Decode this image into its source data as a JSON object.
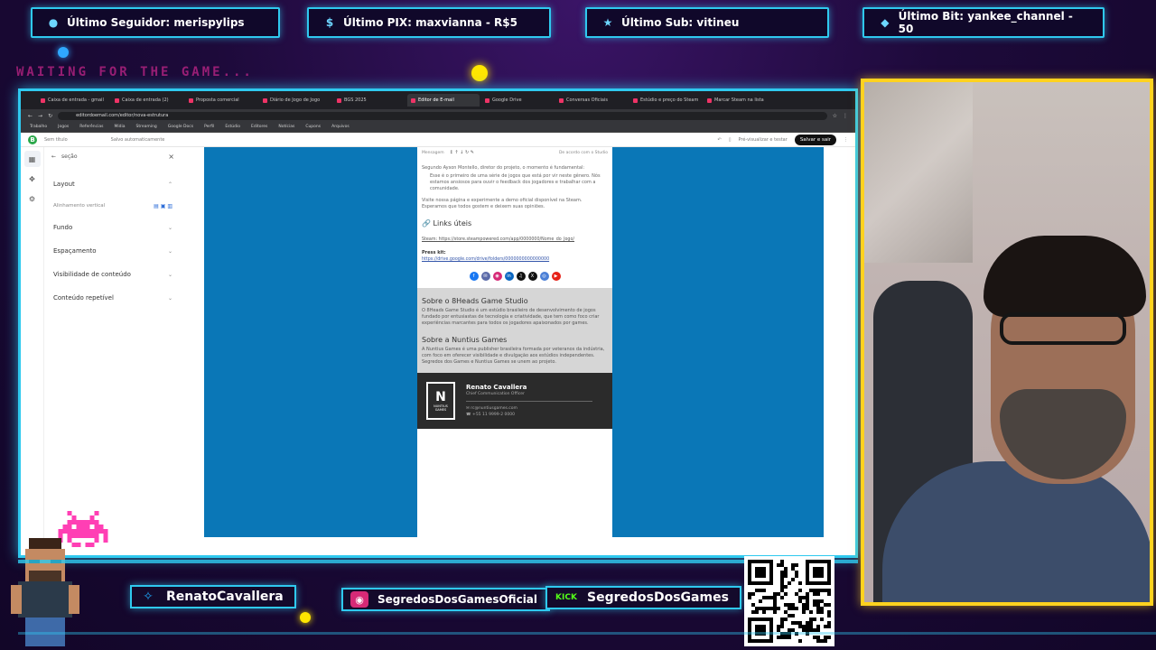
{
  "stats": {
    "follower": "Último Seguidor: merispylips",
    "pix": "Último PIX: maxvianna - R$5",
    "sub": "Último Sub: vitineu",
    "bit": "Último Bit: yankee_channel - 50"
  },
  "waiting_text": "WAITING FOR THE GAME...",
  "browser": {
    "tabs": [
      "Caixa de entrada - gmail",
      "Caixa de entrada (2)",
      "Proposta comercial",
      "Diário de Jogo de Jogo",
      "BGS 2025",
      "Editor de E-mail",
      "Google Drive",
      "Conversas Oficiais",
      "Estúdio e preço do Steam",
      "Marcar Steam na lista"
    ],
    "url": "editordoemail.com/editor/nova-estrutura",
    "bookmarks": [
      "Trabalho",
      "Jogos",
      "Referências",
      "Mídia",
      "Streaming",
      "Google Docs",
      "Perfil",
      "Estúdio",
      "Editores",
      "Notícias",
      "Cupons",
      "Arquivos"
    ]
  },
  "editor": {
    "breadcrumb": "Sem título",
    "autosave": "Salvo automaticamente",
    "preview_label": "Pré-visualizar e testar",
    "save_label": "Salvar e sair",
    "panel_title": "seção",
    "panel_rows": [
      "Layout",
      "Alinhamento vertical",
      "Fundo",
      "Espaçamento",
      "Visibilidade de conteúdo",
      "Conteúdo repetível"
    ]
  },
  "email": {
    "intro_label": "Mensagem",
    "toolbar_note": "De acordo com o Studio",
    "quote_author": "Segundo Ayson Montello, diretor do projeto, o momento é fundamental:",
    "quote_text": "Esse é o primeiro de uma série de jogos que está por vir neste gênero. Nós estamos ansiosos para ouvir o feedback dos jogadores e trabalhar com a comunidade.",
    "demo_text": "Visite nossa página e experimente a demo oficial disponível na Steam. Esperamos que todos gostem e deixem suas opiniões.",
    "links_title": "Links úteis",
    "steam_link": "Steam: https://store.steampowered.com/app/0000000/Nome_do_Jogo/",
    "press_label": "Press kit:",
    "press_link": "https://drive.google.com/drive/folders/0000000000000000",
    "sobre1_title": "Sobre o 8Heads Game Studio",
    "sobre1_text": "O 8Heads Game Studio é um estúdio brasileiro de desenvolvimento de jogos fundado por entusiastas de tecnologia e criatividade, que tem como foco criar experiências marcantes para todos os jogadores apaixonados por games.",
    "sobre2_title": "Sobre a Nuntius Games",
    "sobre2_text": "A Nuntius Games é uma publisher brasileira formada por veteranos da indústria, com foco em oferecer visibilidade e divulgação aos estúdios independentes. Segredos dos Games e Nuntius Games se unem ao projeto.",
    "sig_name": "Renato Cavallera",
    "sig_role": "Chief Communication Officer",
    "sig_email": "rc@nuntiusgames.com",
    "sig_phone": "+55 11 9999-2 0000",
    "sig_logo_text": "NUNTIUS GAMES"
  },
  "bottom": {
    "twitter": "RenatoCavallera",
    "instagram": "SegredosDosGamesOficial",
    "kick": "SegredosDosGames",
    "kick_tag": "KICK",
    "qr_url": "livepix.gg/segredosdosgames"
  },
  "colors": {
    "neon": "#2fc9ef",
    "cam_border": "#ffd21f",
    "canvas_blue": "#0a77b7",
    "waiting": "#ff2fa6"
  }
}
